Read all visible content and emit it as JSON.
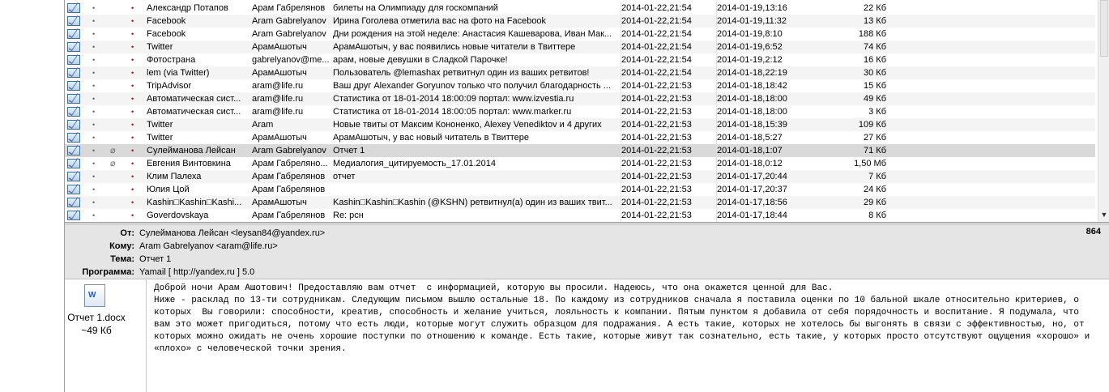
{
  "messages": [
    {
      "from": "Александр Потапов",
      "to": "Арам Габрелянов",
      "subject": "билеты на Олимпиаду для госкомпаний",
      "received": "2014-01-22,21:54",
      "sent": "2014-01-19,13:16",
      "size": "22 Кб",
      "attachment": false
    },
    {
      "from": "Facebook",
      "to": "Aram Gabrelyanov",
      "subject": "Ирина Гоголева отметила вас на фото на Facebook",
      "received": "2014-01-22,21:54",
      "sent": "2014-01-19,11:32",
      "size": "13 Кб",
      "attachment": false
    },
    {
      "from": "Facebook",
      "to": "Aram Gabrelyanov",
      "subject": "Дни рождения на этой неделе: Анастасия Кашеварова, Иван Мак...",
      "received": "2014-01-22,21:54",
      "sent": "2014-01-19,8:10",
      "size": "188 Кб",
      "attachment": false
    },
    {
      "from": "Twitter",
      "to": "АрамАшотыч",
      "subject": "АрамАшотыч, у вас появились новые читатели в Твиттере",
      "received": "2014-01-22,21:54",
      "sent": "2014-01-19,6:52",
      "size": "74 Кб",
      "attachment": false
    },
    {
      "from": "Фотострана",
      "to": "gabrelyanov@me...",
      "subject": "арам, новые девушки в Сладкой Парочке!",
      "received": "2014-01-22,21:54",
      "sent": "2014-01-19,2:12",
      "size": "16 Кб",
      "attachment": false
    },
    {
      "from": "lem (via Twitter)",
      "to": "АрамАшотыч",
      "subject": "Пользователь @lemashax ретвитнул один из ваших ретвитов!",
      "received": "2014-01-22,21:54",
      "sent": "2014-01-18,22:19",
      "size": "30 Кб",
      "attachment": false
    },
    {
      "from": "TripAdvisor",
      "to": "aram@life.ru",
      "subject": "Ваш друг Alexander Goryunov только что получил благодарность ...",
      "received": "2014-01-22,21:53",
      "sent": "2014-01-18,18:42",
      "size": "15 Кб",
      "attachment": false
    },
    {
      "from": "Автоматическая сист...",
      "to": "aram@life.ru",
      "subject": "Статистика от 18-01-2014 18:00:09 портал: www.izvestia.ru",
      "received": "2014-01-22,21:53",
      "sent": "2014-01-18,18:00",
      "size": "49 Кб",
      "attachment": false
    },
    {
      "from": "Автоматическая сист...",
      "to": "aram@life.ru",
      "subject": "Статистика от 18-01-2014 18:00:05 портал: www.marker.ru",
      "received": "2014-01-22,21:53",
      "sent": "2014-01-18,18:00",
      "size": "3 Кб",
      "attachment": false
    },
    {
      "from": "Twitter",
      "to": "Aram",
      "subject": "Новые твиты от Максим Кононенко, Alexey Venediktov и 4 других",
      "received": "2014-01-22,21:53",
      "sent": "2014-01-18,15:39",
      "size": "109 Кб",
      "attachment": false
    },
    {
      "from": "Twitter",
      "to": "АрамАшотыч",
      "subject": "АрамАшотыч, у вас новый читатель в Твиттере",
      "received": "2014-01-22,21:53",
      "sent": "2014-01-18,5:27",
      "size": "27 Кб",
      "attachment": false
    },
    {
      "from": "Сулейманова Лейсан",
      "to": "Aram Gabrelyanov",
      "subject": "Отчет 1",
      "received": "2014-01-22,21:53",
      "sent": "2014-01-18,1:07",
      "size": "71 Кб",
      "attachment": true,
      "selected": true
    },
    {
      "from": "Евгения Винтовкина",
      "to": "Арам Габрелянo...",
      "subject": "Медиалогия_цитируемость_17.01.2014",
      "received": "2014-01-22,21:53",
      "sent": "2014-01-18,0:12",
      "size": "1,50 Мб",
      "attachment": true
    },
    {
      "from": "Клим Палеха",
      "to": "Арам Габрелянов",
      "subject": "отчет",
      "received": "2014-01-22,21:53",
      "sent": "2014-01-17,20:44",
      "size": "7 Кб",
      "attachment": false
    },
    {
      "from": "Юлия Цой",
      "to": "Арам Габрелянов",
      "subject": "",
      "received": "2014-01-22,21:53",
      "sent": "2014-01-17,20:37",
      "size": "24 Кб",
      "attachment": false
    },
    {
      "from": "Kashin□Kashin□Kashi...",
      "to": "АрамАшотыч",
      "subject": "Kashin□Kashin□Kashin (@KSHN) ретвитнул(а) один из ваших твит...",
      "received": "2014-01-22,21:53",
      "sent": "2014-01-17,18:56",
      "size": "29 Кб",
      "attachment": false
    },
    {
      "from": "Goverdovskaya",
      "to": "Арам Габрелянов",
      "subject": "Re: рсн",
      "received": "2014-01-22,21:53",
      "sent": "2014-01-17,18:44",
      "size": "8 Кб",
      "attachment": false
    }
  ],
  "header": {
    "from_label": "От:",
    "from_value": "Сулейманова Лейсан <leysan84@yandex.ru>",
    "to_label": "Кому:",
    "to_value": "Aram Gabrelyanov <aram@life.ru>",
    "subject_label": "Тема:",
    "subject_value": "Отчет 1",
    "program_label": "Программа:",
    "program_value": "Yamail [ http://yandex.ru ] 5.0",
    "message_number": "864"
  },
  "attachment": {
    "filename": "Отчет 1.docx",
    "size": "~49 Кб",
    "icon": "word-document-icon"
  },
  "body": {
    "text": "Доброй ночи Арам Ашотович! Предоставляю вам отчет  с информацией, которую вы просили. Надеюсь, что она окажется ценной для Вас.\nНиже - расклад по 13-ти сотрудникам. Следующим письмом вышлю остальные 18. По каждому из сотрудников сначала я поставила оценки по 10 бальной шкале относительно критериев, о которых  Вы говорили: способности, креатив, способность и желание учиться, лояльность к компании. Пятым пунктом я добавила от себя порядочность и воспитание. Я подумала, что вам это может пригодиться, потому что есть люди, которые могут служить образцом для подражания. А есть такие, которых не хотелось бы выгонять в связи с эффективностью, но, от которых можно ожидать не очень хорошие поступки по отношению к команде. Есть такие, которые живут так сознательно, есть такие, у которых просто отсутствуют ощущения «хорошо» и «плохо» с человеческой точки зрения."
  },
  "colors": {
    "selected_row": "#d9d9d9",
    "header_bg": "#e5e5e5",
    "flag": "#c00000"
  }
}
